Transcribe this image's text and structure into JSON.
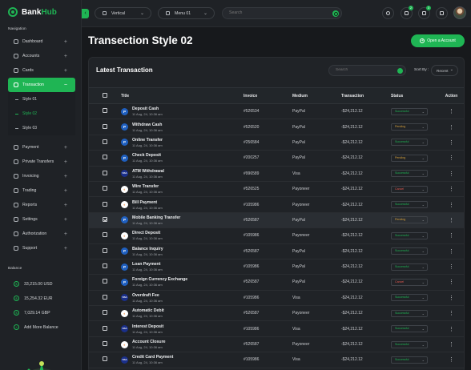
{
  "brand": {
    "name_a": "Bank",
    "name_b": "Hub"
  },
  "sidebar": {
    "nav_label": "Navigation",
    "items": [
      {
        "label": "Dashboard",
        "icon": "dashboard-icon"
      },
      {
        "label": "Accounts",
        "icon": "accounts-icon"
      },
      {
        "label": "Cards",
        "icon": "cards-icon"
      },
      {
        "label": "Transaction",
        "icon": "transaction-icon",
        "active": true
      },
      {
        "label": "Payment",
        "icon": "payment-icon"
      },
      {
        "label": "Private Transfers",
        "icon": "transfer-icon"
      },
      {
        "label": "Invoicing",
        "icon": "invoice-icon"
      },
      {
        "label": "Trading",
        "icon": "trading-icon"
      },
      {
        "label": "Reports",
        "icon": "reports-icon"
      },
      {
        "label": "Settings",
        "icon": "settings-icon"
      },
      {
        "label": "Authorization",
        "icon": "authorization-icon"
      },
      {
        "label": "Support",
        "icon": "support-icon"
      }
    ],
    "sub_items": [
      "Style 01",
      "Style 02",
      "Style 03"
    ],
    "balance_label": "Balance",
    "balances": [
      "33,215.00 USD",
      "15,254.32 EUR",
      "7,029.14 GBP"
    ],
    "add_balance": "Add More Balance"
  },
  "header": {
    "layout_select": "Vertical",
    "menu_select": "Menu 01",
    "search_placeholder": "Search",
    "notif_badge": "2",
    "msg_badge": "3"
  },
  "page": {
    "title": "Transection Style 02",
    "open_account": "Open a Account"
  },
  "table_card": {
    "title": "Latest Transaction",
    "search_placeholder": "Search",
    "sort_label": "Sort By :",
    "sort_value": "Recent",
    "columns": [
      "Title",
      "Invoice",
      "Medium",
      "Transaction",
      "Status",
      "Action"
    ],
    "rows": [
      {
        "name": "Deposit Cash",
        "date": "11 Aug, 24, 10:36 am",
        "invoice": "#526534",
        "medium": "PayPal",
        "amount": "-$24,212.12",
        "status": "Successful"
      },
      {
        "name": "Withdraw Cash",
        "date": "11 Aug, 24, 10:36 am",
        "invoice": "#526520",
        "medium": "PayPal",
        "amount": "-$24,212.12",
        "status": "Pending"
      },
      {
        "name": "Online Transfer",
        "date": "11 Aug, 24, 10:36 am",
        "invoice": "#256584",
        "medium": "PayPal",
        "amount": "-$24,212.12",
        "status": "Successful"
      },
      {
        "name": "Check Deposit",
        "date": "11 Aug, 24, 10:36 am",
        "invoice": "#200257",
        "medium": "PayPal",
        "amount": "-$24,212.12",
        "status": "Pending"
      },
      {
        "name": "ATM Withdrawal",
        "date": "11 Aug, 24, 10:36 am",
        "invoice": "#996589",
        "medium": "Visa",
        "amount": "-$24,212.12",
        "status": "Successful"
      },
      {
        "name": "Wire Transfer",
        "date": "11 Aug, 24, 10:36 am",
        "invoice": "#526525",
        "medium": "Payoneer",
        "amount": "-$24,212.12",
        "status": "Cancel"
      },
      {
        "name": "Bill Payment",
        "date": "11 Aug, 24, 10:36 am",
        "invoice": "#105986",
        "medium": "Payoneer",
        "amount": "-$24,212.12",
        "status": "Successful"
      },
      {
        "name": "Mobile Banking Transfer",
        "date": "11 Aug, 24, 10:36 am",
        "invoice": "#526587",
        "medium": "PayPal",
        "amount": "-$24,212.12",
        "status": "Pending"
      },
      {
        "name": "Direct Deposit",
        "date": "11 Aug, 24, 10:36 am",
        "invoice": "#105986",
        "medium": "Payoneer",
        "amount": "-$24,212.12",
        "status": "Successful"
      },
      {
        "name": "Balance Inquiry",
        "date": "11 Aug, 24, 10:36 am",
        "invoice": "#526587",
        "medium": "PayPal",
        "amount": "-$24,212.12",
        "status": "Successful"
      },
      {
        "name": "Loan Payment",
        "date": "11 Aug, 24, 10:36 am",
        "invoice": "#105986",
        "medium": "PayPal",
        "amount": "-$24,212.12",
        "status": "Successful"
      },
      {
        "name": "Foreign Currency Exchange",
        "date": "11 Aug, 24, 10:36 am",
        "invoice": "#526587",
        "medium": "PayPal",
        "amount": "-$24,212.12",
        "status": "Cancel"
      },
      {
        "name": "Overdraft Fee",
        "date": "11 Aug, 24, 10:36 am",
        "invoice": "#105986",
        "medium": "Visa",
        "amount": "-$24,212.12",
        "status": "Successful"
      },
      {
        "name": "Automatic Debit",
        "date": "11 Aug, 24, 10:36 am",
        "invoice": "#526587",
        "medium": "Payoneer",
        "amount": "-$24,212.12",
        "status": "Successful"
      },
      {
        "name": "Interest Deposit",
        "date": "11 Aug, 24, 10:36 am",
        "invoice": "#105986",
        "medium": "Visa",
        "amount": "-$24,212.12",
        "status": "Successful"
      },
      {
        "name": "Account Closure",
        "date": "11 Aug, 24, 10:36 am",
        "invoice": "#526587",
        "medium": "Payoneer",
        "amount": "-$24,212.12",
        "status": "Successful"
      },
      {
        "name": "Credit Card Payment",
        "date": "11 Aug, 24, 10:36 am",
        "invoice": "#105986",
        "medium": "Visa",
        "amount": "-$24,212.12",
        "status": "Successful"
      }
    ],
    "checked_rows": [
      7
    ]
  },
  "colors": {
    "accent": "#1fb554",
    "pending": "#d6a13c",
    "cancel": "#e0584f",
    "paypal": "#1f5fbf",
    "visa": "#1a2f8a",
    "payoneer": "#f07b20"
  }
}
